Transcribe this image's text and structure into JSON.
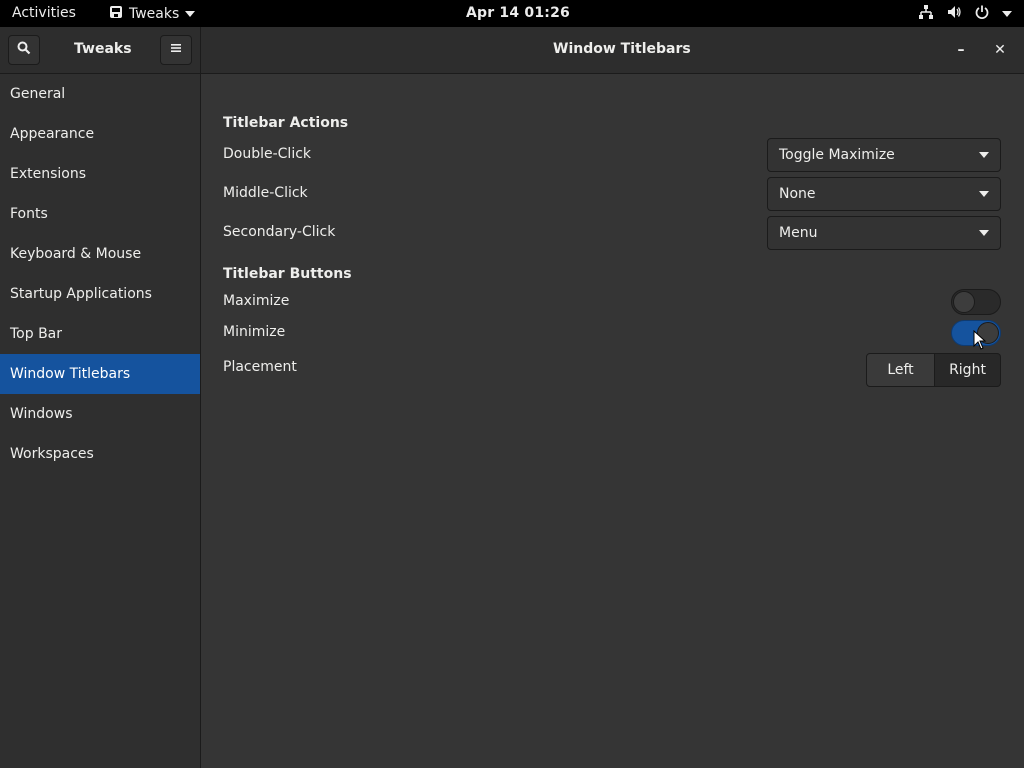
{
  "topbar": {
    "activities": "Activities",
    "app_name": "Tweaks",
    "clock": "Apr 14  01:26"
  },
  "headerbar": {
    "app_title": "Tweaks",
    "page_title": "Window Titlebars",
    "minimize_glyph": "–",
    "close_glyph": "✕"
  },
  "sidebar": {
    "items": [
      {
        "label": "General"
      },
      {
        "label": "Appearance"
      },
      {
        "label": "Extensions"
      },
      {
        "label": "Fonts"
      },
      {
        "label": "Keyboard & Mouse"
      },
      {
        "label": "Startup Applications"
      },
      {
        "label": "Top Bar"
      },
      {
        "label": "Window Titlebars",
        "selected": true
      },
      {
        "label": "Windows"
      },
      {
        "label": "Workspaces"
      }
    ]
  },
  "actions": {
    "title": "Titlebar Actions",
    "double_click": {
      "label": "Double-Click",
      "value": "Toggle Maximize"
    },
    "middle_click": {
      "label": "Middle-Click",
      "value": "None"
    },
    "secondary_click": {
      "label": "Secondary-Click",
      "value": "Menu"
    }
  },
  "buttons": {
    "title": "Titlebar Buttons",
    "maximize": {
      "label": "Maximize",
      "enabled": false
    },
    "minimize": {
      "label": "Minimize",
      "enabled": true
    },
    "placement": {
      "label": "Placement",
      "options": [
        "Left",
        "Right"
      ],
      "selected": "Right"
    }
  },
  "colors": {
    "accent": "#15539e",
    "background": "#353535",
    "sidebar": "#2f2f2f",
    "topbar": "#000000"
  }
}
